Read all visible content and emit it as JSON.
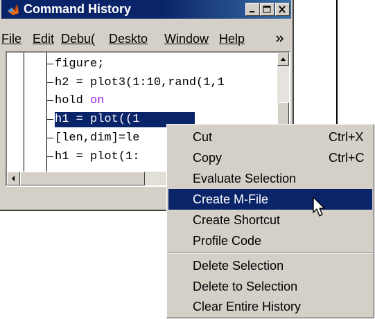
{
  "window": {
    "title": "Command History",
    "minimize_icon": "minimize-icon",
    "restore_icon": "restore-icon",
    "close_icon": "close-icon"
  },
  "menubar": {
    "items": [
      "File",
      "Edit",
      "Debug",
      "Desktop",
      "Window",
      "Help"
    ],
    "visible_labels": [
      "File",
      "Edit",
      "Debu(",
      "Deskto",
      "Window",
      "Help"
    ],
    "overflow_icon": "chevron-right-icon"
  },
  "history": {
    "lines": [
      {
        "text": "figure;"
      },
      {
        "text": "h2 = plot3(1:10,rand(1,1"
      },
      {
        "text": "hold ",
        "kw": "on"
      },
      {
        "text": "h1 = plot((1",
        "selected": true
      },
      {
        "text": "[len,dim]=le"
      },
      {
        "text": "h1 = plot(1:"
      }
    ]
  },
  "context_menu": {
    "items": [
      {
        "label": "Cut",
        "shortcut": "Ctrl+X"
      },
      {
        "label": "Copy",
        "shortcut": "Ctrl+C"
      },
      {
        "label": "Evaluate Selection",
        "shortcut": ""
      },
      {
        "label": "Create M-File",
        "shortcut": "",
        "highlighted": true
      },
      {
        "label": "Create Shortcut",
        "shortcut": ""
      },
      {
        "label": "Profile Code",
        "shortcut": ""
      },
      {
        "label": "Delete Selection",
        "shortcut": ""
      },
      {
        "label": "Delete to Selection",
        "shortcut": ""
      },
      {
        "label": "Clear Entire History",
        "shortcut": ""
      }
    ]
  },
  "colors": {
    "titlebar": "#0a246a",
    "selection": "#0a246a",
    "keyword": "#a020f0",
    "face": "#d4d0c8"
  }
}
